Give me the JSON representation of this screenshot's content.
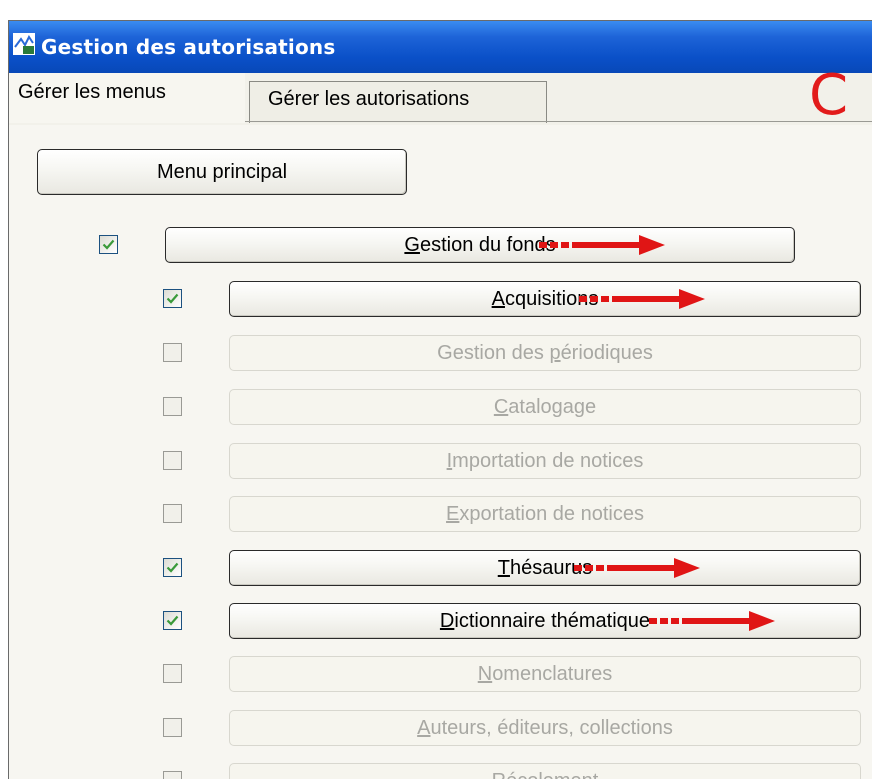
{
  "window": {
    "title": "Gestion des autorisations"
  },
  "tabs": [
    {
      "label": "Gérer les menus",
      "active": true
    },
    {
      "label": "Gérer les autorisations",
      "active": false
    }
  ],
  "logo_letter": "C",
  "main_menu_button": "Menu principal",
  "items": [
    {
      "key": "G",
      "rest": "estion du fonds",
      "checked": true,
      "enabled": true,
      "highlighted": true
    },
    {
      "key": "A",
      "rest": "cquisitions",
      "checked": true,
      "enabled": true,
      "highlighted": true
    },
    {
      "pre": "Gestion des ",
      "key": "p",
      "rest": "ériodiques",
      "checked": false,
      "enabled": false,
      "highlighted": false
    },
    {
      "key": "C",
      "rest": "atalogage",
      "checked": false,
      "enabled": false,
      "highlighted": false
    },
    {
      "key": "I",
      "rest": "mportation de notices",
      "checked": false,
      "enabled": false,
      "highlighted": false
    },
    {
      "key": "E",
      "rest": "xportation de notices",
      "checked": false,
      "enabled": false,
      "highlighted": false
    },
    {
      "key": "T",
      "rest": "hésaurus",
      "checked": true,
      "enabled": true,
      "highlighted": true
    },
    {
      "key": "D",
      "rest": "ictionnaire thématique",
      "checked": true,
      "enabled": true,
      "highlighted": true
    },
    {
      "key": "N",
      "rest": "omenclatures",
      "checked": false,
      "enabled": false,
      "highlighted": false
    },
    {
      "key": "A",
      "rest": "uteurs, éditeurs, collections",
      "checked": false,
      "enabled": false,
      "highlighted": false
    },
    {
      "key": "R",
      "rest": "écolement",
      "checked": false,
      "enabled": false,
      "highlighted": false
    }
  ],
  "colors": {
    "titlebar": "#0a50c8",
    "arrow": "#e01515",
    "logo": "#e21b1b",
    "check": "#3a9a3a"
  }
}
